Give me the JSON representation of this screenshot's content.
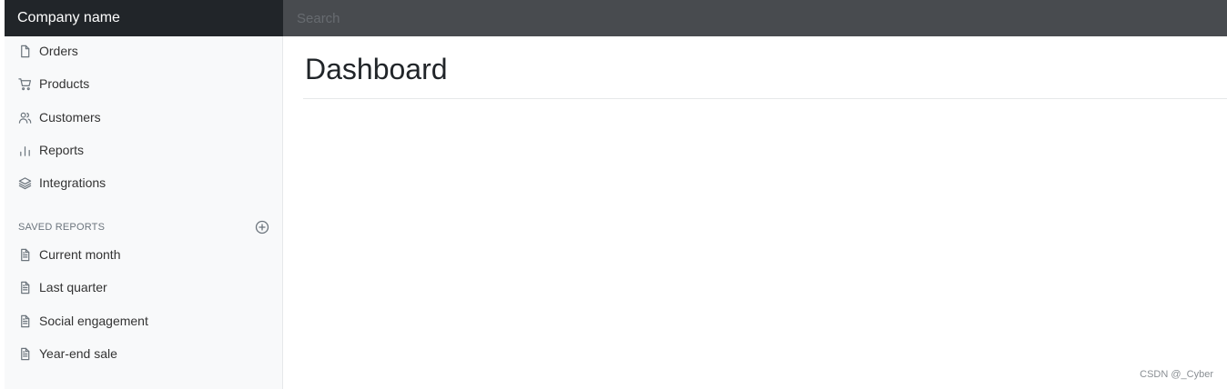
{
  "header": {
    "brand": "Company name",
    "search_placeholder": "Search"
  },
  "sidebar": {
    "items": [
      {
        "label": "Orders",
        "icon": "file-icon"
      },
      {
        "label": "Products",
        "icon": "cart-icon"
      },
      {
        "label": "Customers",
        "icon": "users-icon"
      },
      {
        "label": "Reports",
        "icon": "bar-chart-icon"
      },
      {
        "label": "Integrations",
        "icon": "layers-icon"
      }
    ],
    "saved_reports_title": "SAVED REPORTS",
    "saved_reports": [
      {
        "label": "Current month",
        "icon": "file-text-icon"
      },
      {
        "label": "Last quarter",
        "icon": "file-text-icon"
      },
      {
        "label": "Social engagement",
        "icon": "file-text-icon"
      },
      {
        "label": "Year-end sale",
        "icon": "file-text-icon"
      }
    ]
  },
  "main": {
    "title": "Dashboard"
  },
  "watermark": "CSDN @_Cyber",
  "colors": {
    "topbar": "#484b4f",
    "brand_bg": "#212529",
    "sidebar_bg": "#f8f9fa"
  }
}
